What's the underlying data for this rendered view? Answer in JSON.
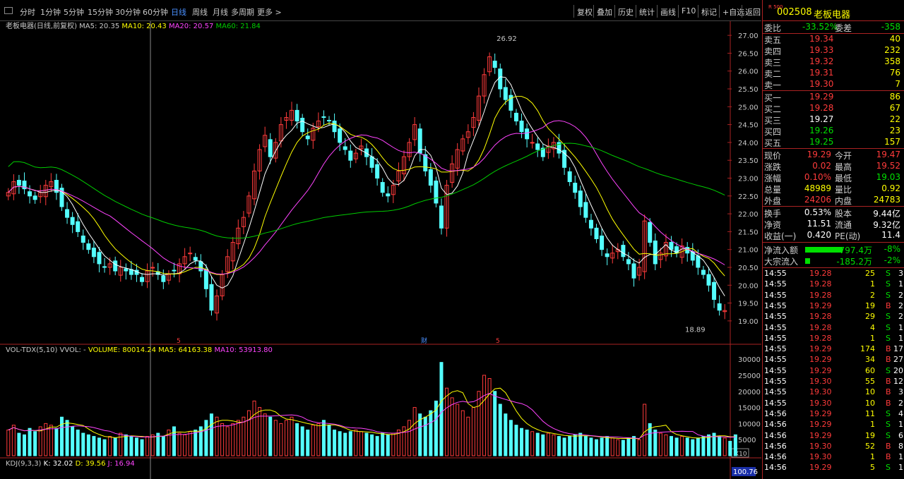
{
  "periods": [
    "分时",
    "1分钟",
    "5分钟",
    "15分钟",
    "30分钟",
    "60分钟",
    "日线",
    "周线",
    "月线",
    "多周期",
    "更多 >"
  ],
  "active_period": "日线",
  "tools": [
    "复权",
    "叠加",
    "历史",
    "统计",
    "画线",
    "F10",
    "标记",
    "+自选",
    "返回"
  ],
  "main": {
    "name": "老板电器(日线,前复权)",
    "ma5": "MA5: 20.35",
    "ma10": "MA10: 20.43",
    "ma20": "MA20: 20.57",
    "ma60": "MA60: 21.84",
    "high_label": "26.92",
    "low_label": "18.89",
    "markers": [
      "5",
      "财",
      "5"
    ],
    "price_ticks": [
      "27.00",
      "26.50",
      "26.00",
      "25.50",
      "25.00",
      "24.50",
      "24.00",
      "23.50",
      "23.00",
      "22.50",
      "22.00",
      "21.50",
      "21.00",
      "20.50",
      "20.00",
      "19.50",
      "19.00"
    ]
  },
  "volume": {
    "title": "VOL-TDX(5,10) VVOL: -",
    "volume": "VOLUME: 80014.24",
    "ma5": "MA5: 64163.38",
    "ma10": "MA10: 53913.80",
    "ticks": [
      "30000",
      "25000",
      "20000",
      "15000",
      "10000",
      "5000"
    ],
    "unit": "X10"
  },
  "kdj": {
    "title": "KDJ(9,3,3)",
    "k": "K: 32.02",
    "d": "D: 39.56",
    "j": "J: 16.94",
    "tick": "100.76"
  },
  "colors": {
    "up": "#ff3b3b",
    "down": "#54ffff",
    "ma5": "#ffffff",
    "ma10": "#ffff00",
    "ma20": "#ff44ff",
    "ma60": "#00cc00",
    "frame": "#aa2222"
  },
  "quote": {
    "code": "002508",
    "name": "老板电器",
    "badge": "R 500",
    "wb_label": "委比",
    "wb_value": "-33.52%",
    "wc_label": "委差",
    "wc_value": "-358",
    "asks": [
      {
        "label": "卖五",
        "price": "19.34",
        "vol": "40"
      },
      {
        "label": "卖四",
        "price": "19.33",
        "vol": "232"
      },
      {
        "label": "卖三",
        "price": "19.32",
        "vol": "358"
      },
      {
        "label": "卖二",
        "price": "19.31",
        "vol": "76"
      },
      {
        "label": "卖一",
        "price": "19.30",
        "vol": "7"
      }
    ],
    "bids": [
      {
        "label": "买一",
        "price": "19.29",
        "vol": "86"
      },
      {
        "label": "买二",
        "price": "19.28",
        "vol": "67"
      },
      {
        "label": "买三",
        "price": "19.27",
        "vol": "22"
      },
      {
        "label": "买四",
        "price": "19.26",
        "vol": "23"
      },
      {
        "label": "买五",
        "price": "19.25",
        "vol": "157"
      }
    ],
    "stats": [
      {
        "l1": "现价",
        "v1": "19.29",
        "l2": "今开",
        "v2": "19.47",
        "c1": "red",
        "c2": "red"
      },
      {
        "l1": "涨跌",
        "v1": "0.02",
        "l2": "最高",
        "v2": "19.52",
        "c1": "red",
        "c2": "red"
      },
      {
        "l1": "涨幅",
        "v1": "0.10%",
        "l2": "最低",
        "v2": "19.03",
        "c1": "red",
        "c2": "green"
      },
      {
        "l1": "总量",
        "v1": "48989",
        "l2": "量比",
        "v2": "0.92",
        "c1": "yellow",
        "c2": "yellow"
      },
      {
        "l1": "外盘",
        "v1": "24206",
        "l2": "内盘",
        "v2": "24783",
        "c1": "red",
        "c2": "yellow"
      }
    ],
    "stats2": [
      {
        "l1": "换手",
        "v1": "0.53%",
        "l2": "股本",
        "v2": "9.44亿"
      },
      {
        "l1": "净资",
        "v1": "11.51",
        "l2": "流通",
        "v2": "9.32亿"
      },
      {
        "l1": "收益(一)",
        "v1": "0.420",
        "l2": "PE(动)",
        "v2": "11.4"
      }
    ],
    "flows": [
      {
        "label": "净流入额",
        "value": "-797.4万",
        "pct": "-8%",
        "bar": 0.85
      },
      {
        "label": "大宗流入",
        "value": "-185.2万",
        "pct": "-2%",
        "bar": 0.12
      }
    ],
    "ticks": [
      [
        "14:55",
        "19.28",
        "25",
        "S",
        "3"
      ],
      [
        "14:55",
        "19.28",
        "1",
        "S",
        "1"
      ],
      [
        "14:55",
        "19.28",
        "2",
        "S",
        "2"
      ],
      [
        "14:55",
        "19.29",
        "19",
        "B",
        "2"
      ],
      [
        "14:55",
        "19.28",
        "29",
        "S",
        "2"
      ],
      [
        "14:55",
        "19.28",
        "4",
        "S",
        "1"
      ],
      [
        "14:55",
        "19.28",
        "1",
        "S",
        "1"
      ],
      [
        "14:55",
        "19.29",
        "174",
        "B",
        "17"
      ],
      [
        "14:55",
        "19.29",
        "34",
        "B",
        "27"
      ],
      [
        "14:55",
        "19.29",
        "60",
        "S",
        "20"
      ],
      [
        "14:55",
        "19.30",
        "55",
        "B",
        "12"
      ],
      [
        "14:55",
        "19.30",
        "10",
        "B",
        "3"
      ],
      [
        "14:55",
        "19.30",
        "10",
        "B",
        "2"
      ],
      [
        "14:56",
        "19.29",
        "11",
        "S",
        "4"
      ],
      [
        "14:56",
        "19.29",
        "1",
        "S",
        "1"
      ],
      [
        "14:56",
        "19.29",
        "19",
        "S",
        "6"
      ],
      [
        "14:56",
        "19.30",
        "52",
        "B",
        "8"
      ],
      [
        "14:56",
        "19.30",
        "1",
        "B",
        "1"
      ],
      [
        "14:56",
        "19.29",
        "5",
        "S",
        "1"
      ],
      [
        "14:56",
        "19.29",
        "",
        "",
        ""
      ]
    ]
  },
  "chart_data": {
    "type": "candlestick",
    "ylim": [
      18.8,
      27.2
    ],
    "high": 26.92,
    "low": 18.89,
    "close": [
      22.6,
      22.9,
      22.8,
      22.7,
      22.5,
      22.4,
      22.6,
      22.8,
      22.9,
      22.6,
      22.2,
      21.9,
      21.7,
      21.5,
      21.2,
      21.0,
      20.8,
      20.6,
      20.5,
      20.6,
      20.4,
      20.5,
      20.4,
      20.3,
      20.3,
      20.1,
      20.4,
      20.5,
      20.3,
      20.1,
      20.3,
      20.4,
      20.6,
      20.8,
      20.9,
      20.7,
      20.4,
      19.9,
      19.3,
      19.7,
      20.3,
      20.8,
      21.2,
      21.6,
      21.9,
      22.5,
      23.2,
      23.8,
      24.2,
      23.6,
      24.0,
      24.5,
      24.7,
      24.9,
      24.6,
      24.3,
      24.1,
      24.4,
      24.6,
      24.7,
      24.6,
      24.3,
      24.0,
      23.8,
      23.5,
      23.7,
      23.9,
      23.6,
      23.3,
      23.0,
      22.6,
      22.5,
      22.8,
      23.2,
      23.6,
      24.0,
      24.5,
      23.7,
      23.2,
      22.8,
      22.3,
      21.6,
      22.8,
      23.4,
      23.8,
      24.1,
      24.3,
      24.7,
      25.3,
      25.9,
      26.4,
      26.1,
      25.5,
      25.2,
      24.9,
      24.6,
      24.3,
      24.1,
      24.0,
      23.8,
      23.6,
      23.9,
      24.0,
      23.7,
      23.3,
      22.9,
      22.6,
      22.2,
      21.9,
      21.6,
      21.3,
      21.0,
      20.8,
      20.9,
      21.0,
      20.8,
      20.6,
      20.2,
      20.5,
      21.8,
      21.2,
      20.6,
      20.9,
      21.2,
      21.0,
      20.9,
      21.1,
      20.9,
      20.7,
      20.5,
      20.3,
      20.0,
      19.6,
      19.3,
      19.29
    ],
    "volume": [
      8000,
      9500,
      7000,
      6500,
      8500,
      7500,
      9000,
      10000,
      9500,
      8500,
      12000,
      11000,
      9000,
      8000,
      7000,
      6500,
      6000,
      5500,
      5000,
      6000,
      5500,
      7000,
      6500,
      6000,
      5500,
      5000,
      6000,
      6500,
      7000,
      6000,
      8000,
      9000,
      7000,
      6500,
      7500,
      8000,
      9000,
      11000,
      13000,
      12000,
      10000,
      9000,
      10000,
      11000,
      12000,
      14000,
      17000,
      15000,
      13000,
      12000,
      11000,
      10000,
      11000,
      12000,
      10000,
      9000,
      8000,
      9500,
      10000,
      11000,
      9500,
      8000,
      7500,
      7000,
      7500,
      8000,
      7500,
      7000,
      6500,
      6000,
      7000,
      6500,
      7000,
      8000,
      9000,
      11000,
      15000,
      13000,
      12000,
      14000,
      17000,
      29000,
      21000,
      18000,
      16000,
      14000,
      12000,
      15000,
      20000,
      25000,
      24000,
      20000,
      16000,
      13000,
      11000,
      9500,
      8500,
      8000,
      7500,
      7000,
      6500,
      7000,
      6500,
      6000,
      5500,
      6000,
      6500,
      7000,
      6000,
      5500,
      5000,
      5500,
      6000,
      5500,
      5000,
      4800,
      5500,
      6000,
      5000,
      16000,
      10000,
      8000,
      7000,
      6500,
      6000,
      5500,
      6000,
      5500,
      5000,
      5500,
      6000,
      6500,
      7000,
      6000,
      5500,
      4500,
      6500
    ]
  }
}
